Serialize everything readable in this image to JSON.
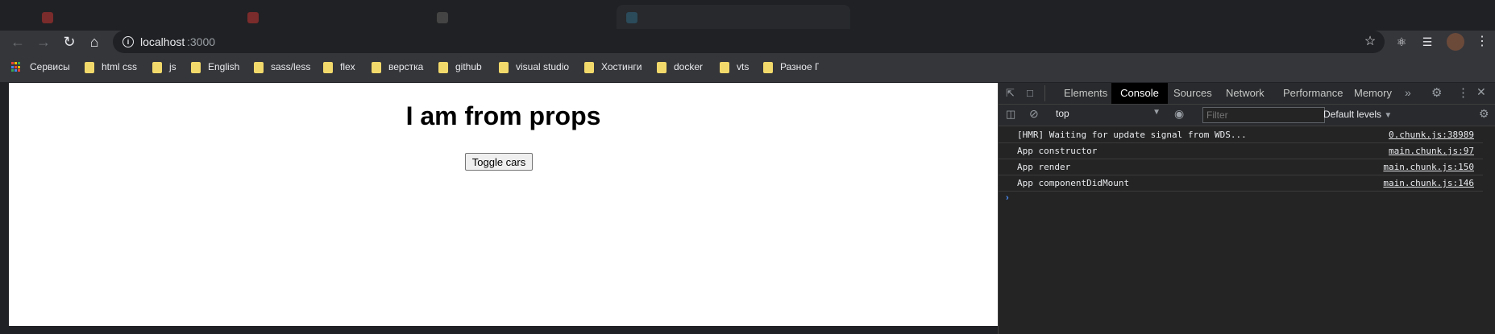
{
  "browser": {
    "url_host": "localhost",
    "url_port": ":3000"
  },
  "bookmarks": [
    {
      "label": "Сервисы"
    },
    {
      "label": "html css"
    },
    {
      "label": "js"
    },
    {
      "label": "English"
    },
    {
      "label": "sass/less"
    },
    {
      "label": "flex"
    },
    {
      "label": "верстка"
    },
    {
      "label": "github"
    },
    {
      "label": "visual studio"
    },
    {
      "label": "Хостинги"
    },
    {
      "label": "docker"
    },
    {
      "label": "vts"
    },
    {
      "label": "Разное Г"
    }
  ],
  "page": {
    "title": "I am from props",
    "toggle_button": "Toggle cars"
  },
  "devtools": {
    "tabs": [
      "Elements",
      "Console",
      "Sources",
      "Network",
      "Performance",
      "Memory"
    ],
    "active_tab": "Console",
    "context": "top",
    "filter_placeholder": "Filter",
    "levels": "Default levels",
    "logs": [
      {
        "message": "[HMR] Waiting for update signal from WDS...",
        "source": "0.chunk.js:38989"
      },
      {
        "message": "App constructor",
        "source": "main.chunk.js:97"
      },
      {
        "message": "App render",
        "source": "main.chunk.js:150"
      },
      {
        "message": "App componentDidMount",
        "source": "main.chunk.js:146"
      }
    ],
    "prompt": "›"
  },
  "icons": {
    "back": "back-arrow-icon",
    "forward": "forward-arrow-icon",
    "reload": "reload-icon",
    "home": "home-icon",
    "info": "info-icon",
    "star": "star-icon",
    "extensions": "puzzle-icon",
    "media": "media-control-icon",
    "menu": "kebab-menu-icon"
  },
  "colors": {
    "accent": "#4d90fe",
    "folder": "#f2d96b"
  }
}
